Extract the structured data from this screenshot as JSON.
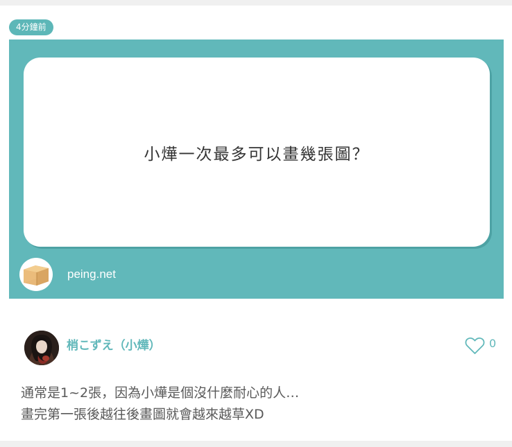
{
  "post": {
    "time_ago": "4分鐘前",
    "question": "小燁一次最多可以畫幾張圖？",
    "site": "peing.net",
    "logo_icon": "cardboard-box-icon",
    "author": {
      "name": "梢こずえ（小燁）"
    },
    "likes": {
      "icon": "heart-outline-icon",
      "count": "0"
    },
    "answer_lines": [
      "通常是1~2張，因為小燁是個沒什麼耐心的人…",
      "畫完第一張後越往後畫圖就會越來越草XD"
    ]
  },
  "colors": {
    "brand_teal": "#61b8ba",
    "card_background": "#ffffff",
    "page_background": "#f0f0f0",
    "answer_text": "#595959"
  }
}
